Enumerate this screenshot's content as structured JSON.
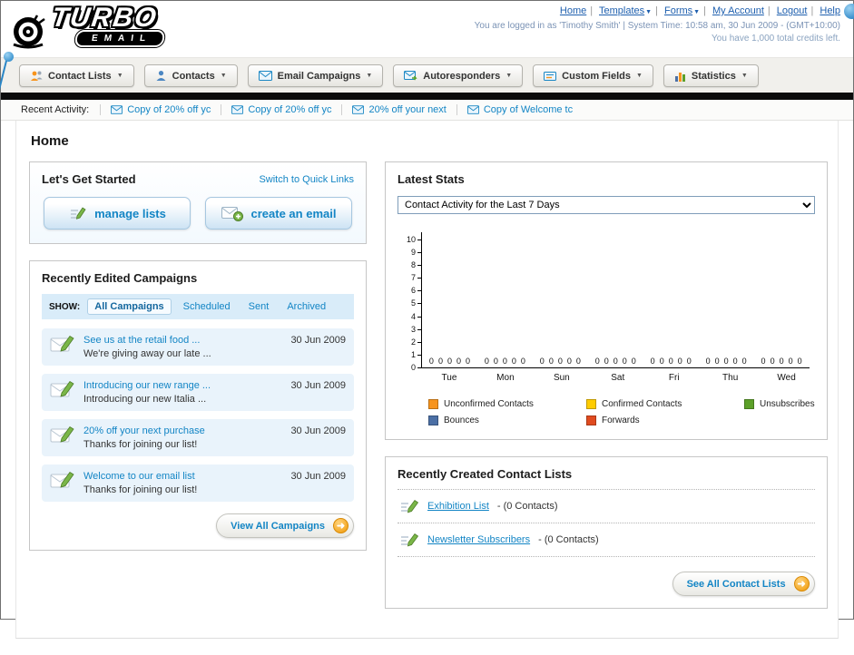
{
  "header": {
    "logo_text": "TURBO",
    "logo_sub": "EMAIL",
    "nav_links": [
      {
        "label": "Home",
        "dropdown": false
      },
      {
        "label": "Templates",
        "dropdown": true
      },
      {
        "label": "Forms",
        "dropdown": true
      },
      {
        "label": "My Account",
        "dropdown": false
      },
      {
        "label": "Logout",
        "dropdown": false
      },
      {
        "label": "Help",
        "dropdown": false
      }
    ],
    "login_info": "You are logged in as 'Timothy Smith' | System Time: 10:58 am, 30 Jun 2009 - (GMT+10:00)",
    "credits_info": "You have 1,000 total credits left."
  },
  "main_nav": {
    "items": [
      {
        "label": "Contact Lists"
      },
      {
        "label": "Contacts"
      },
      {
        "label": "Email Campaigns"
      },
      {
        "label": "Autoresponders"
      },
      {
        "label": "Custom Fields"
      },
      {
        "label": "Statistics"
      }
    ]
  },
  "recent_activity": {
    "label": "Recent Activity:",
    "items": [
      "Copy of 20% off yc",
      "Copy of 20% off yc",
      "20% off your next",
      "Copy of Welcome tc"
    ]
  },
  "page_title": "Home",
  "get_started": {
    "title": "Let's Get Started",
    "switch_link": "Switch to Quick Links",
    "buttons": [
      {
        "label": "manage lists"
      },
      {
        "label": "create an email"
      }
    ]
  },
  "campaigns": {
    "title": "Recently Edited Campaigns",
    "show_label": "SHOW:",
    "tabs": [
      "All Campaigns",
      "Scheduled",
      "Sent",
      "Archived"
    ],
    "active_tab": "All Campaigns",
    "items": [
      {
        "title": "See us at the retail food ...",
        "subtitle": "We're giving away our late ...",
        "date": "30 Jun 2009"
      },
      {
        "title": "Introducing our new range ...",
        "subtitle": "Introducing our new Italia ...",
        "date": "30 Jun 2009"
      },
      {
        "title": "20% off your next purchase",
        "subtitle": "Thanks for joining our list!",
        "date": "30 Jun 2009"
      },
      {
        "title": "Welcome to our email list",
        "subtitle": "Thanks for joining our list!",
        "date": "30 Jun 2009"
      }
    ],
    "view_all_label": "View All Campaigns"
  },
  "stats": {
    "title": "Latest Stats",
    "dropdown_value": "Contact Activity for the Last 7 Days",
    "legend": [
      {
        "label": "Unconfirmed Contacts",
        "color": "#f7941d"
      },
      {
        "label": "Confirmed Contacts",
        "color": "#ffcc00"
      },
      {
        "label": "Unsubscribes",
        "color": "#5ca028"
      },
      {
        "label": "Bounces",
        "color": "#4b6fa5"
      },
      {
        "label": "Forwards",
        "color": "#e04b1f"
      }
    ]
  },
  "chart_data": {
    "type": "bar",
    "title": "Contact Activity for the Last 7 Days",
    "categories": [
      "Tue",
      "Mon",
      "Sun",
      "Sat",
      "Fri",
      "Thu",
      "Wed"
    ],
    "series": [
      {
        "name": "Unconfirmed Contacts",
        "color": "#f7941d",
        "values": [
          0,
          0,
          0,
          0,
          0,
          0,
          0
        ]
      },
      {
        "name": "Confirmed Contacts",
        "color": "#ffcc00",
        "values": [
          0,
          0,
          0,
          0,
          0,
          0,
          0
        ]
      },
      {
        "name": "Unsubscribes",
        "color": "#5ca028",
        "values": [
          0,
          0,
          0,
          0,
          0,
          0,
          0
        ]
      },
      {
        "name": "Bounces",
        "color": "#4b6fa5",
        "values": [
          0,
          0,
          0,
          0,
          0,
          0,
          0
        ]
      },
      {
        "name": "Forwards",
        "color": "#e04b1f",
        "values": [
          0,
          0,
          0,
          0,
          0,
          0,
          0
        ]
      }
    ],
    "ylim": [
      0,
      10
    ],
    "yticks": [
      0,
      1,
      2,
      3,
      4,
      5,
      6,
      7,
      8,
      9,
      10
    ],
    "value_labels_shown": true,
    "legend_position": "bottom",
    "grid": false
  },
  "contact_lists": {
    "title": "Recently Created Contact Lists",
    "items": [
      {
        "name": "Exhibition List",
        "suffix": "- (0 Contacts)"
      },
      {
        "name": "Newsletter Subscribers",
        "suffix": "- (0 Contacts)"
      }
    ],
    "see_all_label": "See All Contact Lists"
  }
}
